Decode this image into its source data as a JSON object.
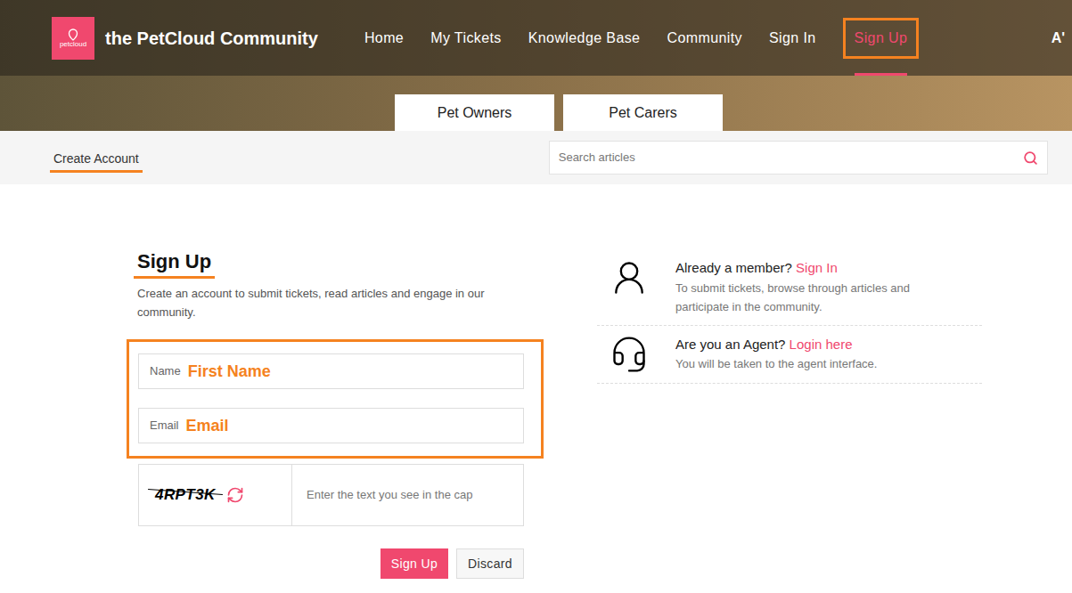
{
  "header": {
    "logo": "petcloud",
    "title": "the PetCloud Community",
    "nav": [
      {
        "label": "Home",
        "selected": false
      },
      {
        "label": "My Tickets",
        "selected": false
      },
      {
        "label": "Knowledge Base",
        "selected": false
      },
      {
        "label": "Community",
        "selected": false
      },
      {
        "label": "Sign In",
        "selected": false
      },
      {
        "label": "Sign Up",
        "selected": true
      }
    ],
    "font_button": "A'"
  },
  "tabs": [
    {
      "label": "Pet Owners",
      "selected": false
    },
    {
      "label": "Pet Carers",
      "selected": false
    }
  ],
  "breadcrumb": "Create Account",
  "search": {
    "placeholder": "Search articles"
  },
  "form": {
    "title": "Sign Up",
    "description": "Create an account to submit tickets, read articles and engage in our community.",
    "fields": [
      {
        "label": "Name",
        "value": "First Name"
      },
      {
        "label": "Email",
        "value": "Email"
      }
    ],
    "captcha": {
      "code": "4RPT3K",
      "placeholder": "Enter the text you see in the cap"
    },
    "buttons": [
      {
        "label": "Sign Up",
        "kind": "primary"
      },
      {
        "label": "Discard",
        "kind": "secondary"
      }
    ]
  },
  "side": [
    {
      "kind": "member",
      "title": "Already a member?",
      "link": "Sign In",
      "text": "To submit tickets, browse through articles and participate in the community."
    },
    {
      "kind": "agent",
      "title": "Are you an Agent?",
      "link": "Login here",
      "text": "You will be taken to the agent interface."
    }
  ]
}
